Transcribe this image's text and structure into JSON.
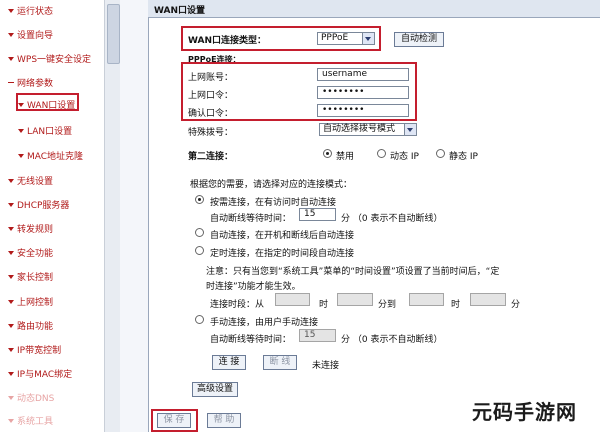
{
  "sidebar": {
    "items": [
      {
        "label": "运行状态"
      },
      {
        "label": "设置向导"
      },
      {
        "label": "WPS一键安全设定"
      },
      {
        "label": "网络参数"
      },
      {
        "label": "WAN口设置"
      },
      {
        "label": "LAN口设置"
      },
      {
        "label": "MAC地址克隆"
      },
      {
        "label": "无线设置"
      },
      {
        "label": "DHCP服务器"
      },
      {
        "label": "转发规则"
      },
      {
        "label": "安全功能"
      },
      {
        "label": "家长控制"
      },
      {
        "label": "上网控制"
      },
      {
        "label": "路由功能"
      },
      {
        "label": "IP带宽控制"
      },
      {
        "label": "IP与MAC绑定"
      },
      {
        "label": "动态DNS"
      },
      {
        "label": "系统工具"
      }
    ]
  },
  "panel": {
    "title": "WAN口设置",
    "conn_type_label": "WAN口连接类型：",
    "conn_type_value": "PPPoE",
    "auto_detect_button": "自动检测",
    "pppoe_header": "PPPoE连接：",
    "account_label": "上网账号：",
    "account_value": "username",
    "password_label": "上网口令：",
    "password_value": "••••••••",
    "confirm_label": "确认口令：",
    "confirm_value": "••••••••",
    "dial_label": "特殊拨号：",
    "dial_value": "自动选择拨号模式",
    "second_conn_label": "第二连接：",
    "second_opts": [
      "禁用",
      "动态 IP",
      "静态 IP"
    ],
    "mode_prompt": "根据您的需要，请选择对应的连接模式：",
    "mode_on_demand": "按需连接，在有访问时自动连接",
    "idle_label_1": "自动断线等待时间：",
    "idle_value_1": "15",
    "idle_unit_1": "分 （0 表示不自动断线）",
    "mode_auto": "自动连接，在开机和断线后自动连接",
    "mode_timed": "定时连接，在指定的时间段自动连接",
    "note_line1": "注意：只有当您到“系统工具”菜单的“时间设置”项设置了当前时间后，“定",
    "note_line2": "时连接”功能才能生效。",
    "period_label": "连接时段：从",
    "period_hour": "时",
    "period_min_to": "分到",
    "period_hour2": "时",
    "period_min": "分",
    "mode_manual": "手动连接，由用户手动连接",
    "idle_label_2": "自动断线等待时间：",
    "idle_value_2": "15",
    "idle_unit_2": "分 （0 表示不自动断线）",
    "connect_button": "连 接",
    "disconnect_button": "断 线",
    "status_text": "未连接",
    "advanced_button": "高级设置",
    "save_button": "保 存",
    "help_button": "帮 助"
  },
  "watermark": "元码手游网"
}
